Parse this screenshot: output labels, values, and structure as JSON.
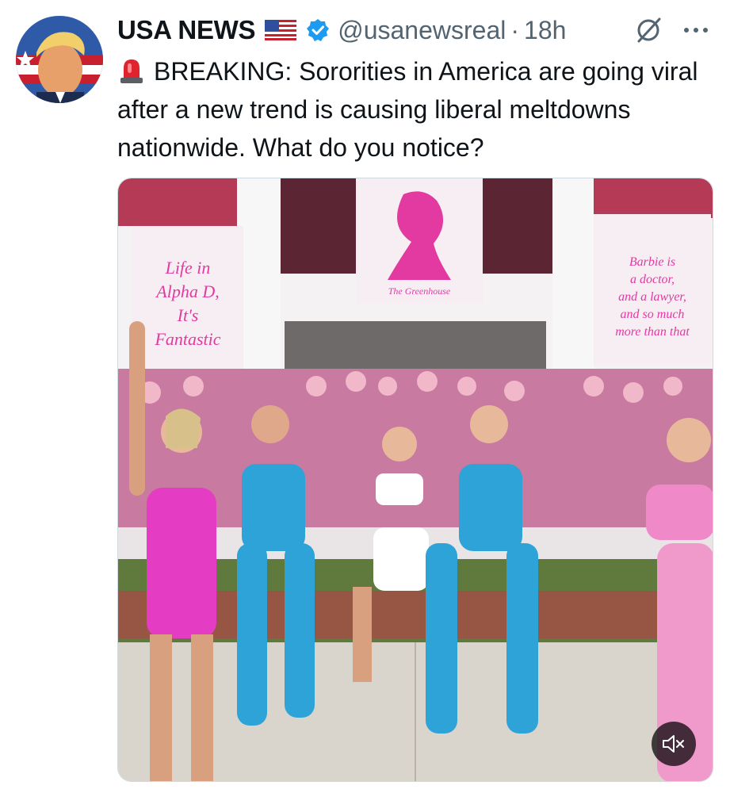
{
  "tweet": {
    "author_name": "USA NEWS",
    "handle": "@usanewsreal",
    "separator": "·",
    "timestamp": "18h",
    "text": "BREAKING: Sororities in America are going viral after a new trend is causing liberal meltdowns nationwide. What do you notice?",
    "emoji_prefix": "siren-icon",
    "flag": "us-flag-icon"
  },
  "media": {
    "type": "video",
    "banners": {
      "left": "Life in Alpha D, It's Fantastic",
      "center": "The Greenhouse",
      "right": "Barbie is a doctor, and a lawyer, and so much more than that"
    },
    "muted": true
  },
  "colors": {
    "verified": "#1d9bf0",
    "secondary_text": "#536471",
    "primary_text": "#0f1419"
  }
}
